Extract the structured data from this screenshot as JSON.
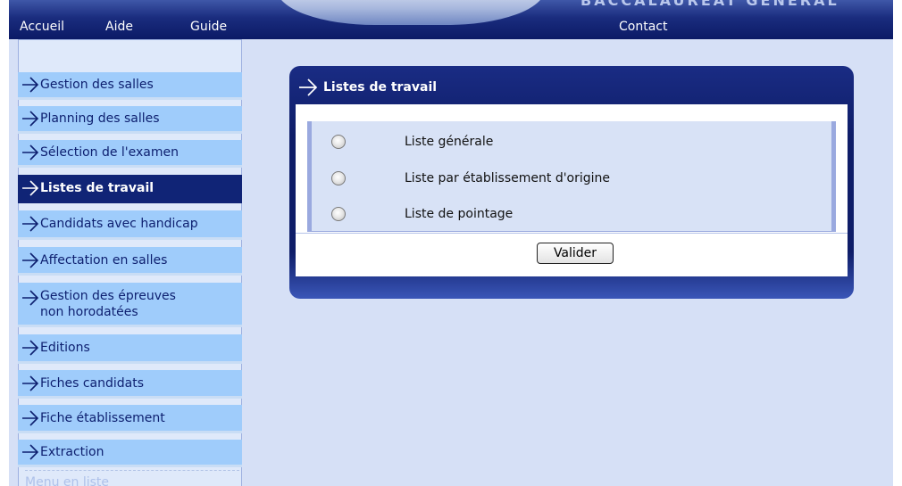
{
  "header": {
    "banner_text": "BACCALAURÉAT GÉNÉRAL",
    "nav": {
      "accueil": "Accueil",
      "aide": "Aide",
      "guide": "Guide",
      "contact": "Contact"
    }
  },
  "sidebar": {
    "items": [
      {
        "label": "Gestion des salles",
        "active": false
      },
      {
        "label": "Planning des salles",
        "active": false
      },
      {
        "label": "Sélection de l'examen",
        "active": false
      },
      {
        "label": "Listes de travail",
        "active": true
      },
      {
        "label": "Candidats avec handicap",
        "active": false
      },
      {
        "label": "Affectation en salles",
        "active": false
      },
      {
        "label": "Gestion des épreuves\nnon horodatées",
        "active": false
      },
      {
        "label": "Editions",
        "active": false
      },
      {
        "label": "Fiches candidats",
        "active": false
      },
      {
        "label": "Fiche établissement",
        "active": false
      },
      {
        "label": "Extraction",
        "active": false
      }
    ],
    "footer_label": "Menu en liste"
  },
  "panel": {
    "title": "Listes de travail",
    "options": [
      {
        "label": "Liste générale",
        "selected": false
      },
      {
        "label": "Liste par établissement d'origine",
        "selected": false
      },
      {
        "label": "Liste de pointage",
        "selected": false
      }
    ],
    "submit_label": "Valider"
  },
  "colors": {
    "header_dark": "#0b1a66",
    "menu_item": "#9fccfb",
    "menu_active": "#102476",
    "page_bg": "#d6e0f6",
    "panel_bg": "#0e1d68"
  }
}
